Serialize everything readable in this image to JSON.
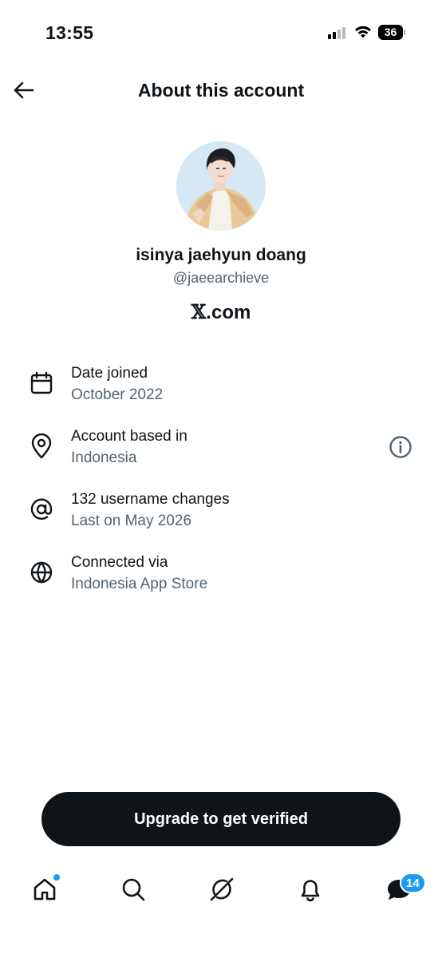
{
  "status_bar": {
    "time": "13:55",
    "battery_level": "36",
    "icons": [
      "signal-icon",
      "wifi-icon",
      "battery-icon"
    ]
  },
  "header": {
    "title": "About this account",
    "back_icon": "arrow-left-icon"
  },
  "profile": {
    "display_name": "isinya jaehyun doang",
    "handle": "@jaeearchieve",
    "domain_prefix": "𝕏",
    "domain_suffix": ".com"
  },
  "info_items": [
    {
      "icon": "calendar-icon",
      "label": "Date joined",
      "value": "October 2022"
    },
    {
      "icon": "location-pin-icon",
      "label": "Account based in",
      "value": "Indonesia",
      "extra_icon": "info-icon"
    },
    {
      "icon": "at-sign-icon",
      "label": "132 username changes",
      "value": "Last on May 2026"
    },
    {
      "icon": "globe-icon",
      "label": "Connected via",
      "value": "Indonesia App Store"
    }
  ],
  "upgrade_button": {
    "label": "Upgrade to get verified"
  },
  "tabbar": {
    "tabs": [
      "home-icon",
      "search-icon",
      "grok-icon",
      "notifications-icon",
      "messages-icon"
    ],
    "messages_badge": "14"
  },
  "colors": {
    "text_primary": "#0f1419",
    "text_secondary": "#536471",
    "accent": "#1d9bf0",
    "button_bg": "#0f1419"
  }
}
